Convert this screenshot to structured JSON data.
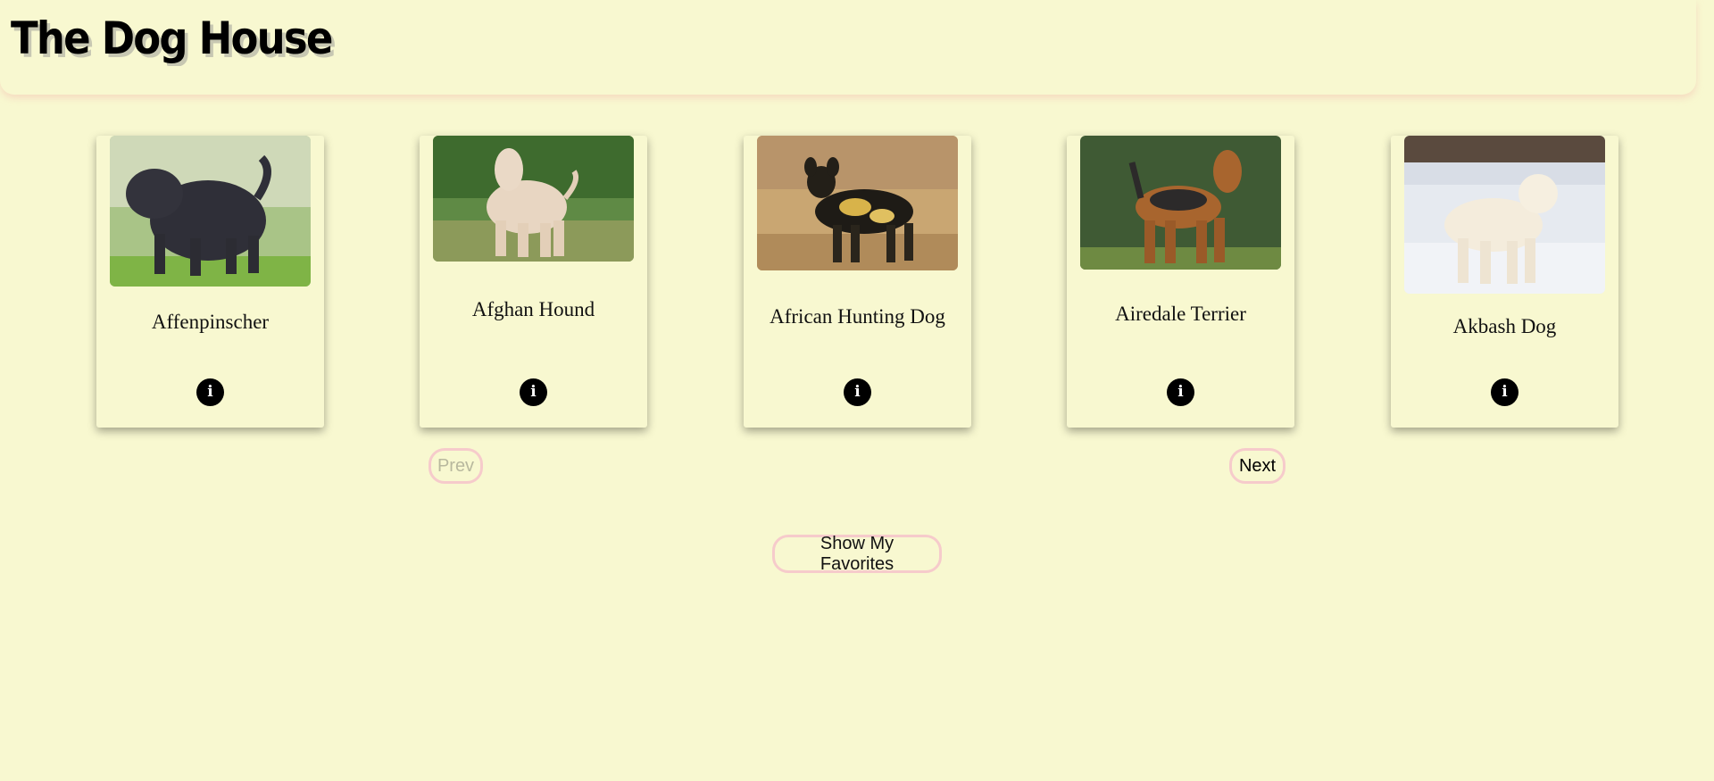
{
  "header": {
    "title": "The Dog House"
  },
  "cards": [
    {
      "name": "Affenpinscher",
      "image_icon": "affenpinscher-photo",
      "info_icon": "info-icon"
    },
    {
      "name": "Afghan Hound",
      "image_icon": "afghan-hound-photo",
      "info_icon": "info-icon"
    },
    {
      "name": "African Hunting Dog",
      "image_icon": "african-hunting-dog-photo",
      "info_icon": "info-icon"
    },
    {
      "name": "Airedale Terrier",
      "image_icon": "airedale-terrier-photo",
      "info_icon": "info-icon"
    },
    {
      "name": "Akbash Dog",
      "image_icon": "akbash-dog-photo",
      "info_icon": "info-icon"
    }
  ],
  "pagination": {
    "prev_label": "Prev",
    "next_label": "Next"
  },
  "favorites": {
    "label": "Show My Favorites"
  },
  "colors": {
    "background": "#f8f8d0",
    "button_border": "#f6cbcb",
    "disabled_text": "#b8b89e"
  }
}
